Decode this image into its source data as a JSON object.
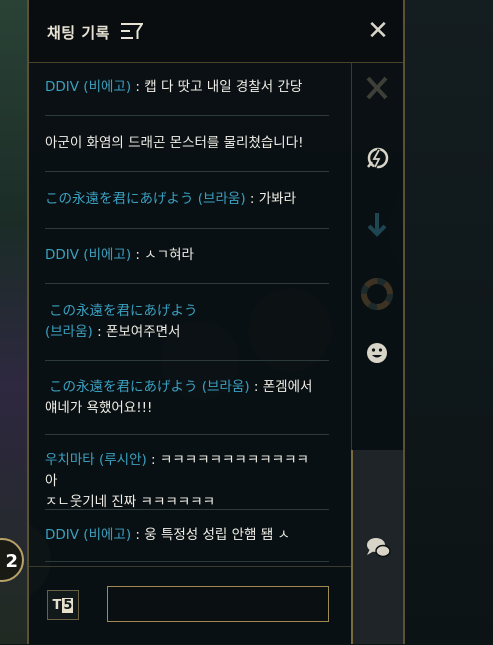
{
  "header": {
    "title": "채팅 기록",
    "close_label": "✕"
  },
  "messages": [
    {
      "sender": "DDIV (비에고)",
      "text": "캡 다 땃고 내일 경찰서 간당"
    },
    {
      "system": "아군이 화염의 드래곤 몬스터를 물리쳤습니다!"
    },
    {
      "sender": "この永遠を君にあげよう (브라움)",
      "text": "가봐라"
    },
    {
      "sender": "DDIV (비에고)",
      "text": "ㅅㄱ혀라"
    },
    {
      "sender_line1": "この永遠を君にあげよう",
      "sender_line2": "(브라움)",
      "text": "폰보여주면서"
    },
    {
      "sender": "この永遠を君にあげよう (브라움)",
      "text_line1": "폰겜에서",
      "text_line2": "얘네가 욕했어요!!!"
    },
    {
      "sender": "우치마타 (루시안)",
      "text_line1": "ㅋㅋㅋㅋㅋㅋㅋㅋㅋㅋㅋㅋ아",
      "text_line2": "ㅈㄴ웃기네 진짜 ㅋㅋㅋㅋㅋㅋ"
    },
    {
      "sender": "DDIV (비에고)",
      "text": "웅 특정성 성립 안햄 됌 ㅅ"
    }
  ],
  "side_icons": [
    "close-x-icon",
    "lightning-ping-icon",
    "arrow-down-icon",
    "lifebuoy-icon",
    "smiley-emote-icon",
    "chat-bubbles-icon"
  ],
  "bottom": {
    "shortcut_label_1": "T",
    "shortcut_label_2": "5",
    "input_value": "",
    "input_placeholder": ""
  },
  "game": {
    "level": "2"
  },
  "colors": {
    "sender": "#3aa0c0",
    "border_gold": "#a08a52",
    "text": "#f0eee6"
  }
}
